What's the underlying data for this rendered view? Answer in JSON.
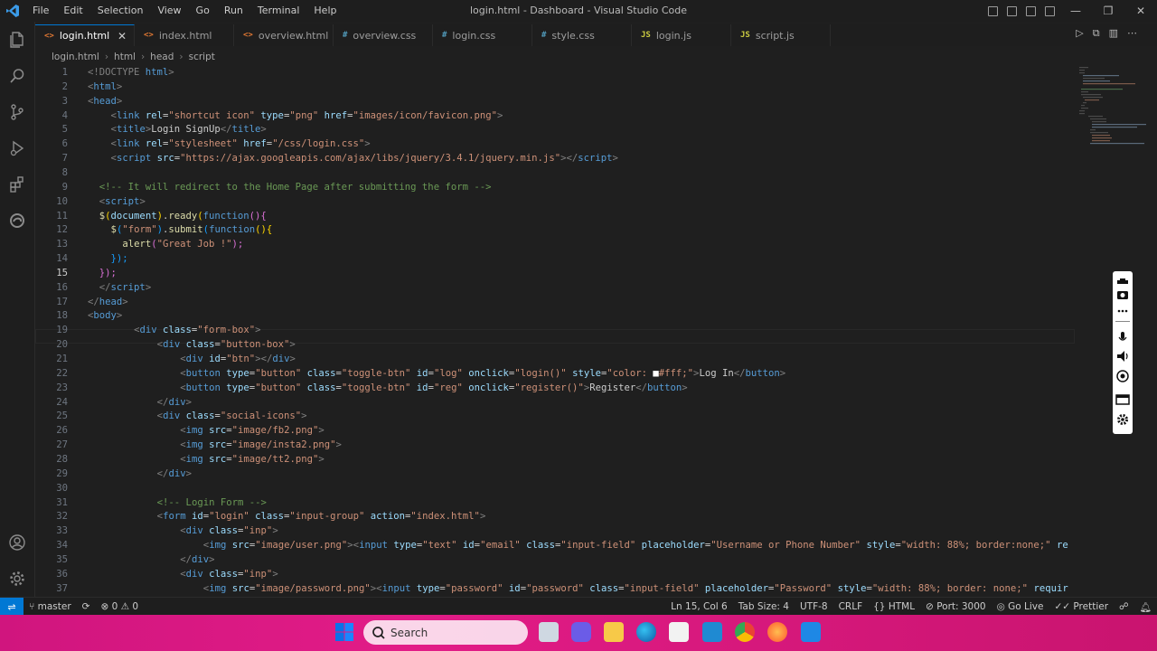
{
  "window": {
    "title": "login.html - Dashboard - Visual Studio Code",
    "menu": [
      "File",
      "Edit",
      "Selection",
      "View",
      "Go",
      "Run",
      "Terminal",
      "Help"
    ]
  },
  "tabs": [
    {
      "label": "login.html",
      "icon": "<>",
      "color": "#e37933",
      "active": true
    },
    {
      "label": "index.html",
      "icon": "<>",
      "color": "#e37933",
      "active": false
    },
    {
      "label": "overview.html",
      "icon": "<>",
      "color": "#e37933",
      "active": false
    },
    {
      "label": "overview.css",
      "icon": "#",
      "color": "#519aba",
      "active": false
    },
    {
      "label": "login.css",
      "icon": "#",
      "color": "#519aba",
      "active": false
    },
    {
      "label": "style.css",
      "icon": "#",
      "color": "#519aba",
      "active": false
    },
    {
      "label": "login.js",
      "icon": "JS",
      "color": "#cbcb41",
      "active": false
    },
    {
      "label": "script.js",
      "icon": "JS",
      "color": "#cbcb41",
      "active": false
    }
  ],
  "breadcrumb": [
    "login.html",
    "html",
    "head",
    "script"
  ],
  "code": [
    {
      "n": "1",
      "t": [
        [
          "<!DOCTYPE ",
          "#808080"
        ],
        [
          "html",
          "#569cd6"
        ],
        [
          ">",
          "#808080"
        ]
      ],
      "ind": 0
    },
    {
      "n": "2",
      "t": [
        [
          "<",
          "#808080"
        ],
        [
          "html",
          "#569cd6"
        ],
        [
          ">",
          "#808080"
        ]
      ],
      "ind": 0
    },
    {
      "n": "3",
      "t": [
        [
          "<",
          "#808080"
        ],
        [
          "head",
          "#569cd6"
        ],
        [
          ">",
          "#808080"
        ]
      ],
      "ind": 0
    },
    {
      "n": "4",
      "t": [
        [
          "<",
          "#808080"
        ],
        [
          "link ",
          "#569cd6"
        ],
        [
          "rel",
          "#9cdcfe"
        ],
        [
          "=",
          "#cccccc"
        ],
        [
          "\"shortcut icon\" ",
          "#ce9178"
        ],
        [
          "type",
          "#9cdcfe"
        ],
        [
          "=",
          "#cccccc"
        ],
        [
          "\"png\" ",
          "#ce9178"
        ],
        [
          "href",
          "#9cdcfe"
        ],
        [
          "=",
          "#cccccc"
        ],
        [
          "\"images/icon/favicon.png\"",
          "#ce9178"
        ],
        [
          ">",
          "#808080"
        ]
      ],
      "ind": 4
    },
    {
      "n": "5",
      "t": [
        [
          "<",
          "#808080"
        ],
        [
          "title",
          "#569cd6"
        ],
        [
          ">",
          "#808080"
        ],
        [
          "Login SignUp",
          "#cccccc"
        ],
        [
          "</",
          "#808080"
        ],
        [
          "title",
          "#569cd6"
        ],
        [
          ">",
          "#808080"
        ]
      ],
      "ind": 4
    },
    {
      "n": "6",
      "t": [
        [
          "<",
          "#808080"
        ],
        [
          "link ",
          "#569cd6"
        ],
        [
          "rel",
          "#9cdcfe"
        ],
        [
          "=",
          "#cccccc"
        ],
        [
          "\"stylesheet\" ",
          "#ce9178"
        ],
        [
          "href",
          "#9cdcfe"
        ],
        [
          "=",
          "#cccccc"
        ],
        [
          "\"/css/login.css\"",
          "#ce9178"
        ],
        [
          ">",
          "#808080"
        ]
      ],
      "ind": 4
    },
    {
      "n": "7",
      "t": [
        [
          "<",
          "#808080"
        ],
        [
          "script ",
          "#569cd6"
        ],
        [
          "src",
          "#9cdcfe"
        ],
        [
          "=",
          "#cccccc"
        ],
        [
          "\"https://ajax.googleapis.com/ajax/libs/jquery/3.4.1/jquery.min.js\"",
          "#ce9178"
        ],
        [
          "></",
          "#808080"
        ],
        [
          "script",
          "#569cd6"
        ],
        [
          ">",
          "#808080"
        ]
      ],
      "ind": 4
    },
    {
      "n": "8",
      "t": [],
      "ind": 0
    },
    {
      "n": "9",
      "t": [
        [
          "<!-- It will redirect to the Home Page after submitting the form -->",
          "#6a9955"
        ]
      ],
      "ind": 2
    },
    {
      "n": "10",
      "t": [
        [
          "<",
          "#808080"
        ],
        [
          "script",
          "#569cd6"
        ],
        [
          ">",
          "#808080"
        ]
      ],
      "ind": 2
    },
    {
      "n": "11",
      "t": [
        [
          "$",
          "#dcdcaa"
        ],
        [
          "(",
          "#ffd700"
        ],
        [
          "document",
          "#9cdcfe"
        ],
        [
          ")",
          "#ffd700"
        ],
        [
          ".",
          "#cccccc"
        ],
        [
          "ready",
          "#dcdcaa"
        ],
        [
          "(",
          "#ffd700"
        ],
        [
          "function",
          "#569cd6"
        ],
        [
          "(){",
          "#da70d6"
        ]
      ],
      "ind": 2
    },
    {
      "n": "12",
      "t": [
        [
          "$",
          "#dcdcaa"
        ],
        [
          "(",
          "#179fff"
        ],
        [
          "\"form\"",
          "#ce9178"
        ],
        [
          ")",
          "#179fff"
        ],
        [
          ".",
          "#cccccc"
        ],
        [
          "submit",
          "#dcdcaa"
        ],
        [
          "(",
          "#179fff"
        ],
        [
          "function",
          "#569cd6"
        ],
        [
          "(){",
          "#ffd700"
        ]
      ],
      "ind": 4
    },
    {
      "n": "13",
      "t": [
        [
          "alert",
          "#dcdcaa"
        ],
        [
          "(",
          "#da70d6"
        ],
        [
          "\"Great Job !\"",
          "#ce9178"
        ],
        [
          ");",
          "#da70d6"
        ]
      ],
      "ind": 6
    },
    {
      "n": "14",
      "t": [
        [
          "});",
          "#179fff"
        ]
      ],
      "ind": 4
    },
    {
      "n": "15",
      "t": [
        [
          "});",
          "#da70d6"
        ]
      ],
      "ind": 2
    },
    {
      "n": "16",
      "t": [
        [
          "</",
          "#808080"
        ],
        [
          "script",
          "#569cd6"
        ],
        [
          ">",
          "#808080"
        ]
      ],
      "ind": 2
    },
    {
      "n": "17",
      "t": [
        [
          "</",
          "#808080"
        ],
        [
          "head",
          "#569cd6"
        ],
        [
          ">",
          "#808080"
        ]
      ],
      "ind": 0
    },
    {
      "n": "18",
      "t": [
        [
          "<",
          "#808080"
        ],
        [
          "body",
          "#569cd6"
        ],
        [
          ">",
          "#808080"
        ]
      ],
      "ind": 0
    },
    {
      "n": "19",
      "t": [
        [
          "<",
          "#808080"
        ],
        [
          "div ",
          "#569cd6"
        ],
        [
          "class",
          "#9cdcfe"
        ],
        [
          "=",
          "#cccccc"
        ],
        [
          "\"form-box\"",
          "#ce9178"
        ],
        [
          ">",
          "#808080"
        ]
      ],
      "ind": 8
    },
    {
      "n": "20",
      "t": [
        [
          "<",
          "#808080"
        ],
        [
          "div ",
          "#569cd6"
        ],
        [
          "class",
          "#9cdcfe"
        ],
        [
          "=",
          "#cccccc"
        ],
        [
          "\"button-box\"",
          "#ce9178"
        ],
        [
          ">",
          "#808080"
        ]
      ],
      "ind": 12
    },
    {
      "n": "21",
      "t": [
        [
          "<",
          "#808080"
        ],
        [
          "div ",
          "#569cd6"
        ],
        [
          "id",
          "#9cdcfe"
        ],
        [
          "=",
          "#cccccc"
        ],
        [
          "\"btn\"",
          "#ce9178"
        ],
        [
          "></",
          "#808080"
        ],
        [
          "div",
          "#569cd6"
        ],
        [
          ">",
          "#808080"
        ]
      ],
      "ind": 16
    },
    {
      "n": "22",
      "t": [
        [
          "<",
          "#808080"
        ],
        [
          "button ",
          "#569cd6"
        ],
        [
          "type",
          "#9cdcfe"
        ],
        [
          "=",
          "#cccccc"
        ],
        [
          "\"button\" ",
          "#ce9178"
        ],
        [
          "class",
          "#9cdcfe"
        ],
        [
          "=",
          "#cccccc"
        ],
        [
          "\"toggle-btn\" ",
          "#ce9178"
        ],
        [
          "id",
          "#9cdcfe"
        ],
        [
          "=",
          "#cccccc"
        ],
        [
          "\"log\" ",
          "#ce9178"
        ],
        [
          "onclick",
          "#9cdcfe"
        ],
        [
          "=",
          "#cccccc"
        ],
        [
          "\"login()\" ",
          "#ce9178"
        ],
        [
          "style",
          "#9cdcfe"
        ],
        [
          "=",
          "#cccccc"
        ],
        [
          "\"color: ",
          "#ce9178"
        ],
        [
          "■",
          "#ffffff"
        ],
        [
          "#fff;\"",
          "#ce9178"
        ],
        [
          ">",
          "#808080"
        ],
        [
          "Log In",
          "#cccccc"
        ],
        [
          "</",
          "#808080"
        ],
        [
          "button",
          "#569cd6"
        ],
        [
          ">",
          "#808080"
        ]
      ],
      "ind": 16
    },
    {
      "n": "23",
      "t": [
        [
          "<",
          "#808080"
        ],
        [
          "button ",
          "#569cd6"
        ],
        [
          "type",
          "#9cdcfe"
        ],
        [
          "=",
          "#cccccc"
        ],
        [
          "\"button\" ",
          "#ce9178"
        ],
        [
          "class",
          "#9cdcfe"
        ],
        [
          "=",
          "#cccccc"
        ],
        [
          "\"toggle-btn\" ",
          "#ce9178"
        ],
        [
          "id",
          "#9cdcfe"
        ],
        [
          "=",
          "#cccccc"
        ],
        [
          "\"reg\" ",
          "#ce9178"
        ],
        [
          "onclick",
          "#9cdcfe"
        ],
        [
          "=",
          "#cccccc"
        ],
        [
          "\"register()\"",
          "#ce9178"
        ],
        [
          ">",
          "#808080"
        ],
        [
          "Register",
          "#cccccc"
        ],
        [
          "</",
          "#808080"
        ],
        [
          "button",
          "#569cd6"
        ],
        [
          ">",
          "#808080"
        ]
      ],
      "ind": 16
    },
    {
      "n": "24",
      "t": [
        [
          "</",
          "#808080"
        ],
        [
          "div",
          "#569cd6"
        ],
        [
          ">",
          "#808080"
        ]
      ],
      "ind": 12
    },
    {
      "n": "25",
      "t": [
        [
          "<",
          "#808080"
        ],
        [
          "div ",
          "#569cd6"
        ],
        [
          "class",
          "#9cdcfe"
        ],
        [
          "=",
          "#cccccc"
        ],
        [
          "\"social-icons\"",
          "#ce9178"
        ],
        [
          ">",
          "#808080"
        ]
      ],
      "ind": 12
    },
    {
      "n": "26",
      "t": [
        [
          "<",
          "#808080"
        ],
        [
          "img ",
          "#569cd6"
        ],
        [
          "src",
          "#9cdcfe"
        ],
        [
          "=",
          "#cccccc"
        ],
        [
          "\"image/fb2.png\"",
          "#ce9178"
        ],
        [
          ">",
          "#808080"
        ]
      ],
      "ind": 16
    },
    {
      "n": "27",
      "t": [
        [
          "<",
          "#808080"
        ],
        [
          "img ",
          "#569cd6"
        ],
        [
          "src",
          "#9cdcfe"
        ],
        [
          "=",
          "#cccccc"
        ],
        [
          "\"image/insta2.png\"",
          "#ce9178"
        ],
        [
          ">",
          "#808080"
        ]
      ],
      "ind": 16
    },
    {
      "n": "28",
      "t": [
        [
          "<",
          "#808080"
        ],
        [
          "img ",
          "#569cd6"
        ],
        [
          "src",
          "#9cdcfe"
        ],
        [
          "=",
          "#cccccc"
        ],
        [
          "\"image/tt2.png\"",
          "#ce9178"
        ],
        [
          ">",
          "#808080"
        ]
      ],
      "ind": 16
    },
    {
      "n": "29",
      "t": [
        [
          "</",
          "#808080"
        ],
        [
          "div",
          "#569cd6"
        ],
        [
          ">",
          "#808080"
        ]
      ],
      "ind": 12
    },
    {
      "n": "30",
      "t": [],
      "ind": 0
    },
    {
      "n": "31",
      "t": [
        [
          "<!-- Login Form -->",
          "#6a9955"
        ]
      ],
      "ind": 12
    },
    {
      "n": "32",
      "t": [
        [
          "<",
          "#808080"
        ],
        [
          "form ",
          "#569cd6"
        ],
        [
          "id",
          "#9cdcfe"
        ],
        [
          "=",
          "#cccccc"
        ],
        [
          "\"login\" ",
          "#ce9178"
        ],
        [
          "class",
          "#9cdcfe"
        ],
        [
          "=",
          "#cccccc"
        ],
        [
          "\"input-group\" ",
          "#ce9178"
        ],
        [
          "action",
          "#9cdcfe"
        ],
        [
          "=",
          "#cccccc"
        ],
        [
          "\"index.html\"",
          "#ce9178"
        ],
        [
          ">",
          "#808080"
        ]
      ],
      "ind": 12
    },
    {
      "n": "33",
      "t": [
        [
          "<",
          "#808080"
        ],
        [
          "div ",
          "#569cd6"
        ],
        [
          "class",
          "#9cdcfe"
        ],
        [
          "=",
          "#cccccc"
        ],
        [
          "\"inp\"",
          "#ce9178"
        ],
        [
          ">",
          "#808080"
        ]
      ],
      "ind": 16
    },
    {
      "n": "34",
      "t": [
        [
          "<",
          "#808080"
        ],
        [
          "img ",
          "#569cd6"
        ],
        [
          "src",
          "#9cdcfe"
        ],
        [
          "=",
          "#cccccc"
        ],
        [
          "\"image/user.png\"",
          "#ce9178"
        ],
        [
          "><",
          "#808080"
        ],
        [
          "input ",
          "#569cd6"
        ],
        [
          "type",
          "#9cdcfe"
        ],
        [
          "=",
          "#cccccc"
        ],
        [
          "\"text\" ",
          "#ce9178"
        ],
        [
          "id",
          "#9cdcfe"
        ],
        [
          "=",
          "#cccccc"
        ],
        [
          "\"email\" ",
          "#ce9178"
        ],
        [
          "class",
          "#9cdcfe"
        ],
        [
          "=",
          "#cccccc"
        ],
        [
          "\"input-field\" ",
          "#ce9178"
        ],
        [
          "placeholder",
          "#9cdcfe"
        ],
        [
          "=",
          "#cccccc"
        ],
        [
          "\"Username or Phone Number\" ",
          "#ce9178"
        ],
        [
          "style",
          "#9cdcfe"
        ],
        [
          "=",
          "#cccccc"
        ],
        [
          "\"width: 88%; border:none;\" ",
          "#ce9178"
        ],
        [
          "re",
          "#9cdcfe"
        ]
      ],
      "ind": 20
    },
    {
      "n": "35",
      "t": [
        [
          "</",
          "#808080"
        ],
        [
          "div",
          "#569cd6"
        ],
        [
          ">",
          "#808080"
        ]
      ],
      "ind": 16
    },
    {
      "n": "36",
      "t": [
        [
          "<",
          "#808080"
        ],
        [
          "div ",
          "#569cd6"
        ],
        [
          "class",
          "#9cdcfe"
        ],
        [
          "=",
          "#cccccc"
        ],
        [
          "\"inp\"",
          "#ce9178"
        ],
        [
          ">",
          "#808080"
        ]
      ],
      "ind": 16
    },
    {
      "n": "37",
      "t": [
        [
          "<",
          "#808080"
        ],
        [
          "img ",
          "#569cd6"
        ],
        [
          "src",
          "#9cdcfe"
        ],
        [
          "=",
          "#cccccc"
        ],
        [
          "\"image/password.png\"",
          "#ce9178"
        ],
        [
          "><",
          "#808080"
        ],
        [
          "input ",
          "#569cd6"
        ],
        [
          "type",
          "#9cdcfe"
        ],
        [
          "=",
          "#cccccc"
        ],
        [
          "\"password\" ",
          "#ce9178"
        ],
        [
          "id",
          "#9cdcfe"
        ],
        [
          "=",
          "#cccccc"
        ],
        [
          "\"password\" ",
          "#ce9178"
        ],
        [
          "class",
          "#9cdcfe"
        ],
        [
          "=",
          "#cccccc"
        ],
        [
          "\"input-field\" ",
          "#ce9178"
        ],
        [
          "placeholder",
          "#9cdcfe"
        ],
        [
          "=",
          "#cccccc"
        ],
        [
          "\"Password\" ",
          "#ce9178"
        ],
        [
          "style",
          "#9cdcfe"
        ],
        [
          "=",
          "#cccccc"
        ],
        [
          "\"width: 88%; border: none;\" ",
          "#ce9178"
        ],
        [
          "requir",
          "#9cdcfe"
        ]
      ],
      "ind": 20
    }
  ],
  "status": {
    "branch": "master",
    "problems": "⊗ 0 ⚠ 0",
    "position": "Ln 15, Col 6",
    "tabsize": "Tab Size: 4",
    "encoding": "UTF-8",
    "eol": "CRLF",
    "language": "HTML",
    "port": "Port: 3000",
    "golive": "Go Live",
    "prettier": "Prettier"
  },
  "taskbar": {
    "search_label": "Search"
  }
}
